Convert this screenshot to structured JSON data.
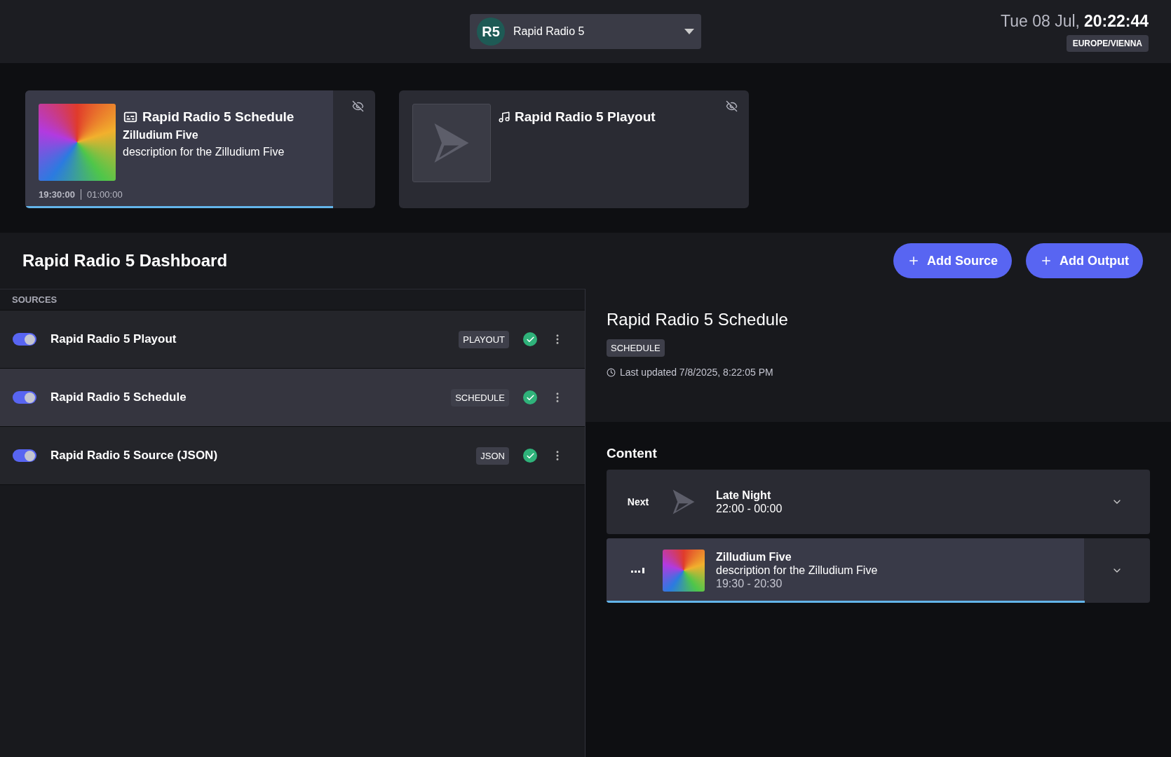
{
  "header": {
    "station": {
      "logo": "R5",
      "name": "Rapid Radio 5"
    },
    "date": "Tue 08 Jul,",
    "time": "20:22:44",
    "timezone": "EUROPE/VIENNA"
  },
  "now_playing": [
    {
      "kind": "schedule",
      "has_image": true,
      "title": "Rapid Radio 5 Schedule",
      "subtitle": "Zilludium Five",
      "description": "description for the Zilludium Five",
      "start": "19:30:00",
      "duration": "01:00:00",
      "level": 0.88
    },
    {
      "kind": "playout",
      "has_image": false,
      "title": "Rapid Radio 5 Playout"
    }
  ],
  "dashboard": {
    "title": "Rapid Radio 5 Dashboard",
    "buttons": [
      "Add Source",
      "Add Output"
    ]
  },
  "sources": {
    "heading": "SOURCES",
    "rows": [
      {
        "name": "Rapid Radio 5 Playout",
        "tag": "PLAYOUT",
        "on": true,
        "selected": false
      },
      {
        "name": "Rapid Radio 5 Schedule",
        "tag": "SCHEDULE",
        "on": true,
        "selected": true
      },
      {
        "name": "Rapid Radio 5 Source (JSON)",
        "tag": "JSON",
        "on": true,
        "selected": false
      }
    ]
  },
  "detail": {
    "title": "Rapid Radio 5 Schedule",
    "tag": "SCHEDULE",
    "updated": "Last updated 7/8/2025, 8:22:05 PM"
  },
  "content": {
    "heading": "Content",
    "items": [
      {
        "kind": "next",
        "label": "Next",
        "has_image": false,
        "title": "Late Night",
        "time": "22:00 - 00:00"
      },
      {
        "kind": "playing",
        "has_image": true,
        "title": "Zilludium Five",
        "description": "description for the Zilludium Five",
        "time": "19:30 - 20:30",
        "level": 0.88
      }
    ]
  }
}
